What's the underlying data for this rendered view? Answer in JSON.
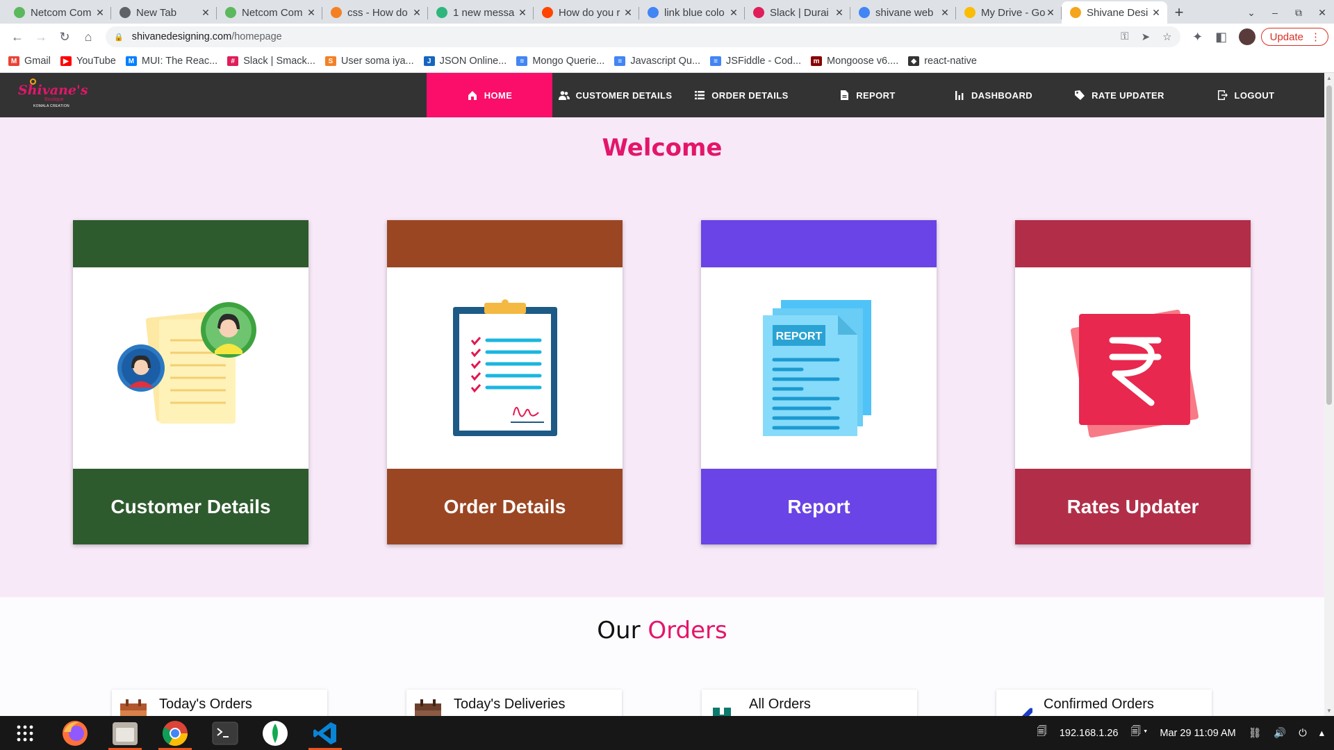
{
  "browser": {
    "tabs": [
      {
        "title": "Netcom Com",
        "favicon_color": "#5cb85c"
      },
      {
        "title": "New Tab",
        "favicon_color": "#5f6368"
      },
      {
        "title": "Netcom Com",
        "favicon_color": "#5cb85c"
      },
      {
        "title": "css - How do",
        "favicon_color": "#f48024"
      },
      {
        "title": "1 new messa",
        "favicon_color": "#2eb67d"
      },
      {
        "title": "How do you r",
        "favicon_color": "#ff4500"
      },
      {
        "title": "link blue colo",
        "favicon_color": "#4285f4"
      },
      {
        "title": "Slack | Durai",
        "favicon_color": "#e01e5a"
      },
      {
        "title": "shivane web",
        "favicon_color": "#4285f4"
      },
      {
        "title": "My Drive - Go",
        "favicon_color": "#fbbc04"
      },
      {
        "title": "Shivane Desi",
        "favicon_color": "#f4a51c",
        "active": true
      }
    ],
    "new_tab_icon": "+",
    "window_controls": [
      "⌄",
      "–",
      "⧉",
      "✕"
    ],
    "url_host": "shivanedesigning.com",
    "url_path": "/homepage",
    "update_label": "Update",
    "bookmarks": [
      {
        "label": "Gmail",
        "color": "#ea4335",
        "glyph": "M"
      },
      {
        "label": "YouTube",
        "color": "#ff0000",
        "glyph": "▶"
      },
      {
        "label": "MUI: The Reac...",
        "color": "#007fff",
        "glyph": "M"
      },
      {
        "label": "Slack | Smack...",
        "color": "#e01e5a",
        "glyph": "#"
      },
      {
        "label": "User soma iya...",
        "color": "#f48024",
        "glyph": "S"
      },
      {
        "label": "JSON Online...",
        "color": "#1565c0",
        "glyph": "J"
      },
      {
        "label": "Mongo Querie...",
        "color": "#4285f4",
        "glyph": "≡"
      },
      {
        "label": "Javascript Qu...",
        "color": "#4285f4",
        "glyph": "≡"
      },
      {
        "label": "JSFiddle - Cod...",
        "color": "#4285f4",
        "glyph": "≡"
      },
      {
        "label": "Mongoose v6....",
        "color": "#880000",
        "glyph": "m"
      },
      {
        "label": "react-native",
        "color": "#333333",
        "glyph": "◆"
      }
    ]
  },
  "site": {
    "logo": {
      "main": "Shivane's",
      "sub": "Boutique",
      "tag": "KOMALA CREATION"
    },
    "nav": [
      {
        "label": "HOME",
        "icon": "home-icon",
        "active": true
      },
      {
        "label": "CUSTOMER DETAILS",
        "icon": "people-icon"
      },
      {
        "label": "ORDER DETAILS",
        "icon": "list-icon"
      },
      {
        "label": "REPORT",
        "icon": "document-icon"
      },
      {
        "label": "DASHBOARD",
        "icon": "bar-chart-icon"
      },
      {
        "label": "RATE UPDATER",
        "icon": "tag-icon"
      },
      {
        "label": "LOGOUT",
        "icon": "logout-icon"
      }
    ],
    "welcome_title": "Welcome",
    "cards": [
      {
        "label": "Customer Details",
        "color": "#2e5b2e",
        "icon": "customer-chat-icon"
      },
      {
        "label": "Order Details",
        "color": "#9b4623",
        "icon": "clipboard-checklist-icon"
      },
      {
        "label": "Report",
        "color": "#6a44e6",
        "icon": "report-document-icon"
      },
      {
        "label": "Rates Updater",
        "color": "#b22e48",
        "icon": "rupee-icon"
      }
    ],
    "report_icon_text": "REPORT",
    "orders_title_plain": "Our",
    "orders_title_highlight": "Orders",
    "order_cards": [
      {
        "label": "Today's Orders",
        "icon": "calendar-icon"
      },
      {
        "label": "Today's Deliveries",
        "icon": "calendar-icon"
      },
      {
        "label": "All Orders",
        "icon": "box-icon"
      },
      {
        "label": "Confirmed Orders",
        "icon": "checkmark-icon"
      }
    ],
    "accent_color": "#e3166a"
  },
  "taskbar": {
    "apps": [
      "apps-grid-icon",
      "firefox-icon",
      "files-icon",
      "chrome-icon",
      "terminal-icon",
      "mongodb-compass-icon",
      "vscode-icon"
    ],
    "ip": "192.168.1.26",
    "datetime": "Mar 29  11:09 AM"
  }
}
